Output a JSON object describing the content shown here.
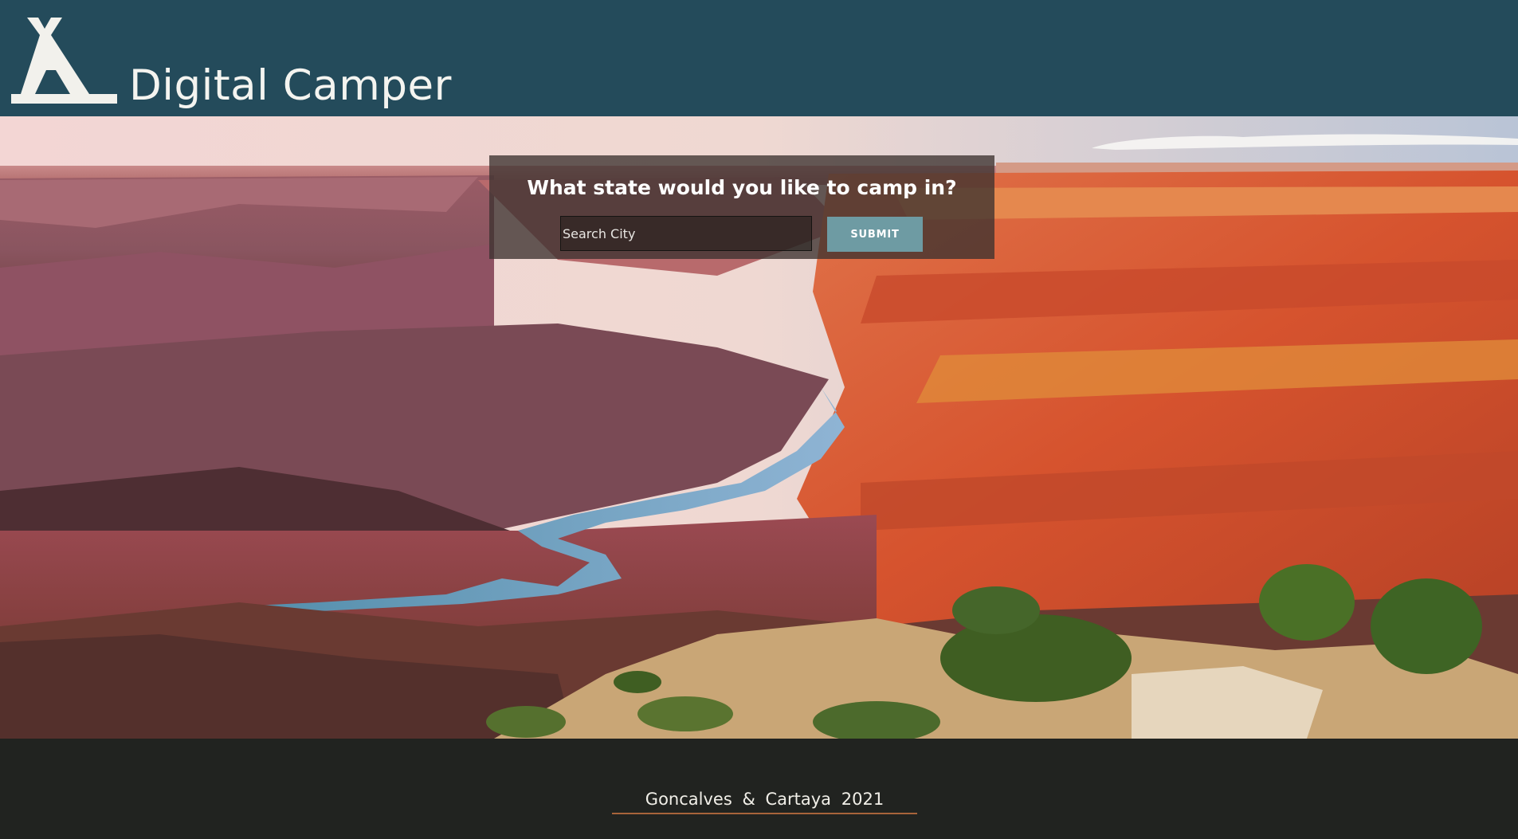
{
  "header": {
    "brand_title": "Digital Camper",
    "logo_icon": "tent-icon",
    "background_color": "#244b5b"
  },
  "search": {
    "heading": "What state would you like to camp in?",
    "input_placeholder": "Search City",
    "input_value": "",
    "submit_label": "SUBMIT",
    "submit_color": "#6e9ba3"
  },
  "hero": {
    "image": "canyon-landscape-photo"
  },
  "footer": {
    "credit": "Goncalves & Cartaya 2021",
    "accent_color": "#a8643a"
  }
}
